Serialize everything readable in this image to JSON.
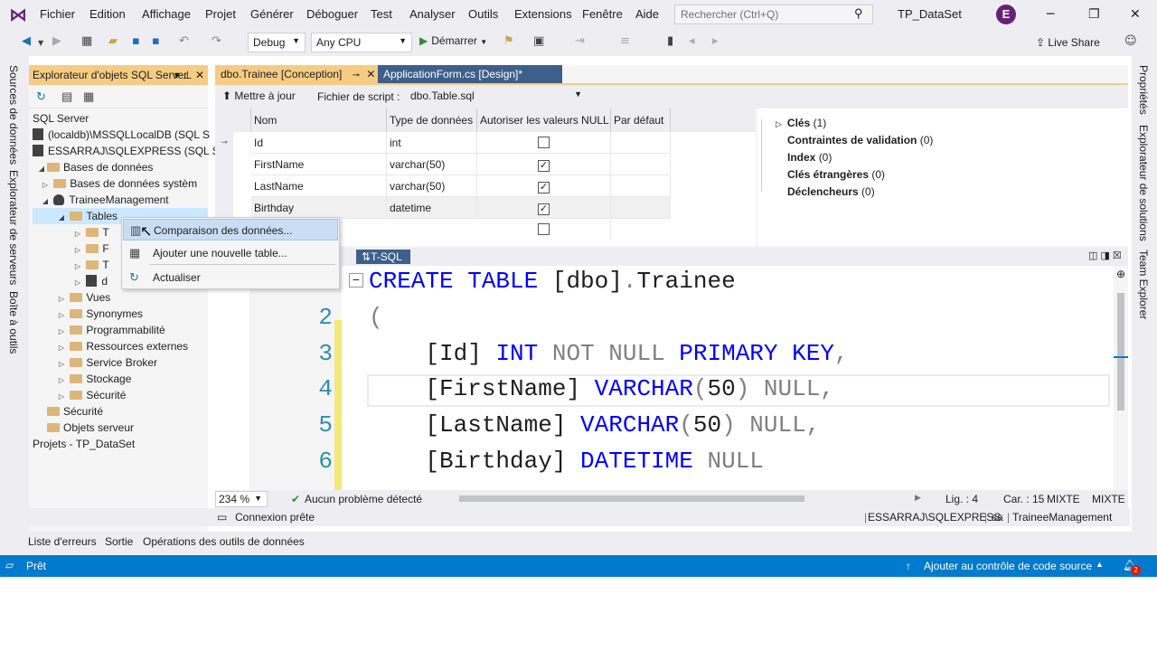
{
  "menu": [
    "Fichier",
    "Edition",
    "Affichage",
    "Projet",
    "Générer",
    "Déboguer",
    "Test",
    "Analyser",
    "Outils",
    "Extensions",
    "Fenêtre",
    "Aide"
  ],
  "search": {
    "placeholder": "Rechercher (Ctrl+Q)"
  },
  "solution_name": "TP_DataSet",
  "avatar_letter": "E",
  "toolbar": {
    "config": "Debug",
    "platform": "Any CPU",
    "start": "Démarrer",
    "live_share": "Live Share"
  },
  "left_tabs": [
    "Sources de données",
    "Explorateur de serveurs",
    "Boîte à outils"
  ],
  "right_tabs": [
    "Propriétés",
    "Explorateur de solutions",
    "Team Explorer"
  ],
  "explorer": {
    "title": "Explorateur d'objets SQL Server",
    "tree": [
      {
        "label": "SQL Server"
      },
      {
        "label": "(localdb)\\MSSQLLocalDB (SQL S"
      },
      {
        "label": "ESSARRAJ\\SQLEXPRESS (SQL Ser"
      },
      {
        "label": "Bases de données"
      },
      {
        "label": "Bases de données systèm"
      },
      {
        "label": "TraineeManagement"
      },
      {
        "label": "Tables"
      },
      {
        "label": "T"
      },
      {
        "label": "F"
      },
      {
        "label": "T"
      },
      {
        "label": "d"
      },
      {
        "label": "Vues"
      },
      {
        "label": "Synonymes"
      },
      {
        "label": "Programmabilité"
      },
      {
        "label": "Ressources externes"
      },
      {
        "label": "Service Broker"
      },
      {
        "label": "Stockage"
      },
      {
        "label": "Sécurité"
      },
      {
        "label": "Sécurité"
      },
      {
        "label": "Objets serveur"
      },
      {
        "label": "Projets - TP_DataSet"
      }
    ]
  },
  "context_menu": [
    "Comparaison des données...",
    "Ajouter une nouvelle table...",
    "Actualiser"
  ],
  "doc_tabs": [
    "dbo.Trainee [Conception]",
    "ApplicationForm.cs [Design]*"
  ],
  "designer": {
    "update": "Mettre à jour",
    "script_label": "Fichier de script :",
    "script_file": "dbo.Table.sql"
  },
  "columns_header": [
    "Nom",
    "Type de données",
    "Autoriser les valeurs NULL",
    "Par défaut"
  ],
  "columns": [
    {
      "name": "Id",
      "type": "int",
      "nullable": false
    },
    {
      "name": "FirstName",
      "type": "varchar(50)",
      "nullable": true
    },
    {
      "name": "LastName",
      "type": "varchar(50)",
      "nullable": true
    },
    {
      "name": "Birthday",
      "type": "datetime",
      "nullable": true
    }
  ],
  "props": [
    {
      "label": "Clés",
      "count": "(1)"
    },
    {
      "label": "Contraintes de validation",
      "count": "(0)"
    },
    {
      "label": "Index",
      "count": "(0)"
    },
    {
      "label": "Clés étrangères",
      "count": "(0)"
    },
    {
      "label": "Déclencheurs",
      "count": "(0)"
    }
  ],
  "tsql_tab": "T-SQL",
  "code_lines": [
    {
      "n": "1",
      "parts": [
        [
          "kw",
          "CREATE TABLE "
        ],
        [
          "tx",
          "[dbo]"
        ],
        [
          "gr",
          "."
        ],
        [
          "tx",
          "Trainee"
        ]
      ]
    },
    {
      "n": "2",
      "parts": [
        [
          "gr",
          "("
        ]
      ]
    },
    {
      "n": "3",
      "parts": [
        [
          "tx",
          "    [Id] "
        ],
        [
          "kw",
          "INT "
        ],
        [
          "gr",
          "NOT NULL "
        ],
        [
          "kw",
          "PRIMARY KEY"
        ],
        [
          "gr",
          ","
        ]
      ]
    },
    {
      "n": "4",
      "parts": [
        [
          "tx",
          "    [FirstName] "
        ],
        [
          "kw",
          "VARCHAR"
        ],
        [
          "gr",
          "("
        ],
        [
          "tx",
          "50"
        ],
        [
          "gr",
          ") NULL,"
        ]
      ]
    },
    {
      "n": "5",
      "parts": [
        [
          "tx",
          "    [LastName] "
        ],
        [
          "kw",
          "VARCHAR"
        ],
        [
          "gr",
          "("
        ],
        [
          "tx",
          "50"
        ],
        [
          "gr",
          ") NULL,"
        ]
      ]
    },
    {
      "n": "6",
      "parts": [
        [
          "tx",
          "    [Birthday] "
        ],
        [
          "kw",
          "DATETIME "
        ],
        [
          "gr",
          "NULL"
        ]
      ]
    }
  ],
  "editor_status": {
    "zoom": "234 %",
    "issues": "Aucun problème détecté",
    "line": "Lig. : 4",
    "col": "Car. : 15",
    "mode1": "MIXTE",
    "mode2": "MIXTE"
  },
  "output": {
    "connection": "Connexion prête",
    "server": "ESSARRAJ\\SQLEXPRESS",
    "user": "sa",
    "db": "TraineeManagement"
  },
  "bottom_tabs": [
    "Liste d'erreurs",
    "Sortie",
    "Opérations des outils de données"
  ],
  "status": {
    "ready": "Prêt",
    "source_control": "Ajouter au contrôle de code source",
    "notif": "2"
  },
  "colors": {
    "accent": "#007acc",
    "brand": "#68217a",
    "panel_title": "#f5cc84"
  }
}
